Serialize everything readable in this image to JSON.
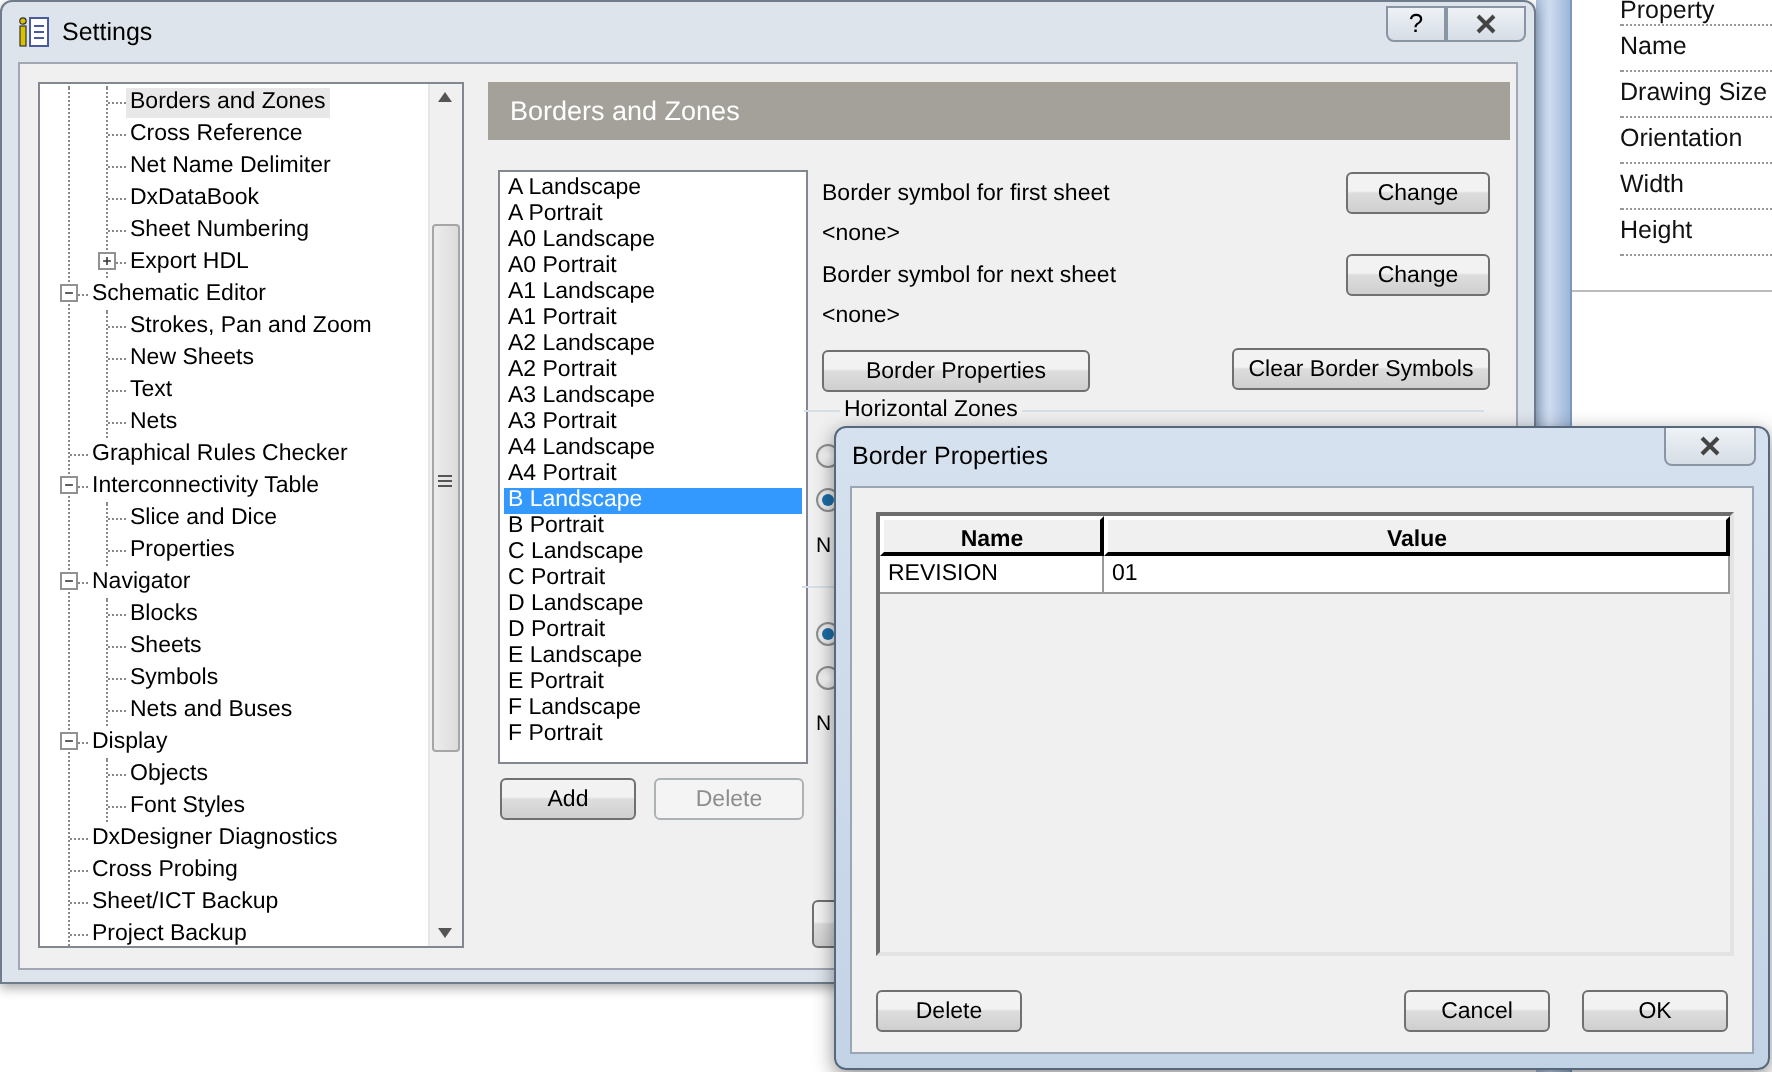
{
  "background_panel": {
    "rows": [
      "Property",
      "Name",
      "Drawing Size",
      "Orientation",
      "Width",
      "Height"
    ]
  },
  "window": {
    "title": "Settings",
    "help": "?"
  },
  "tree": {
    "items": [
      {
        "children": [
          {
            "label": "Borders and Zones",
            "selected": true
          },
          {
            "label": "Cross Reference",
            "selected": false
          },
          {
            "label": "Net Name Delimiter",
            "selected": false
          },
          {
            "label": "DxDataBook",
            "selected": false
          },
          {
            "label": "Sheet Numbering",
            "selected": false
          },
          {
            "label": "Export HDL",
            "selected": false,
            "expanded": false
          }
        ]
      },
      {
        "label": "Schematic Editor",
        "selected": false,
        "expanded": true,
        "children": [
          {
            "label": "Strokes, Pan and Zoom",
            "selected": false
          },
          {
            "label": "New Sheets",
            "selected": false
          },
          {
            "label": "Text",
            "selected": false
          },
          {
            "label": "Nets",
            "selected": false
          }
        ]
      },
      {
        "label": "Graphical Rules Checker",
        "selected": false
      },
      {
        "label": "Interconnectivity Table",
        "selected": false,
        "expanded": true,
        "children": [
          {
            "label": "Slice and Dice",
            "selected": false
          },
          {
            "label": "Properties",
            "selected": false
          }
        ]
      },
      {
        "label": "Navigator",
        "selected": false,
        "expanded": true,
        "children": [
          {
            "label": "Blocks",
            "selected": false
          },
          {
            "label": "Sheets",
            "selected": false
          },
          {
            "label": "Symbols",
            "selected": false
          },
          {
            "label": "Nets and Buses",
            "selected": false
          }
        ]
      },
      {
        "label": "Display",
        "selected": false,
        "expanded": true,
        "children": [
          {
            "label": "Objects",
            "selected": false
          },
          {
            "label": "Font Styles",
            "selected": false
          }
        ]
      },
      {
        "label": "DxDesigner Diagnostics",
        "selected": false
      },
      {
        "label": "Cross Probing",
        "selected": false
      },
      {
        "label": "Sheet/ICT Backup",
        "selected": false
      },
      {
        "label": "Project Backup",
        "selected": false
      }
    ]
  },
  "panel": {
    "title": "Borders and Zones"
  },
  "sizes": [
    {
      "label": "A Landscape",
      "selected": false
    },
    {
      "label": "A Portrait",
      "selected": false
    },
    {
      "label": "A0 Landscape",
      "selected": false
    },
    {
      "label": "A0 Portrait",
      "selected": false
    },
    {
      "label": "A1 Landscape",
      "selected": false
    },
    {
      "label": "A1 Portrait",
      "selected": false
    },
    {
      "label": "A2 Landscape",
      "selected": false
    },
    {
      "label": "A2 Portrait",
      "selected": false
    },
    {
      "label": "A3 Landscape",
      "selected": false
    },
    {
      "label": "A3 Portrait",
      "selected": false
    },
    {
      "label": "A4 Landscape",
      "selected": false
    },
    {
      "label": "A4 Portrait",
      "selected": false
    },
    {
      "label": "B Landscape",
      "selected": true
    },
    {
      "label": "B Portrait",
      "selected": false
    },
    {
      "label": "C Landscape",
      "selected": false
    },
    {
      "label": "C Portrait",
      "selected": false
    },
    {
      "label": "D Landscape",
      "selected": false
    },
    {
      "label": "D Portrait",
      "selected": false
    },
    {
      "label": "E Landscape",
      "selected": false
    },
    {
      "label": "E Portrait",
      "selected": false
    },
    {
      "label": "F Landscape",
      "selected": false
    },
    {
      "label": "F Portrait",
      "selected": false
    }
  ],
  "list_buttons": [
    {
      "label": "Add",
      "disabled": false
    },
    {
      "label": "Delete",
      "disabled": true
    }
  ],
  "border_symbols": [
    {
      "label": "Border symbol for first sheet",
      "value": "<none>",
      "button": "Change"
    },
    {
      "label": "Border symbol for next sheet",
      "value": "<none>",
      "button": "Change"
    }
  ],
  "border_properties_button": "Border Properties",
  "clear_button": "Clear Border Symbols",
  "horizontal_zones": {
    "title": "Horizontal Zones",
    "options": [
      {
        "selected": false
      },
      {
        "selected": true
      }
    ],
    "label": "N"
  },
  "vertical_zones": {
    "options": [
      {
        "selected": true
      },
      {
        "selected": false
      }
    ],
    "label": "N"
  },
  "dialog": {
    "title": "Border Properties",
    "columns": [
      "Name",
      "Value"
    ],
    "rows": [
      [
        "REVISION",
        "01"
      ]
    ],
    "buttons": [
      {
        "label": "Delete"
      },
      {
        "label": "Cancel"
      },
      {
        "label": "OK"
      }
    ]
  }
}
